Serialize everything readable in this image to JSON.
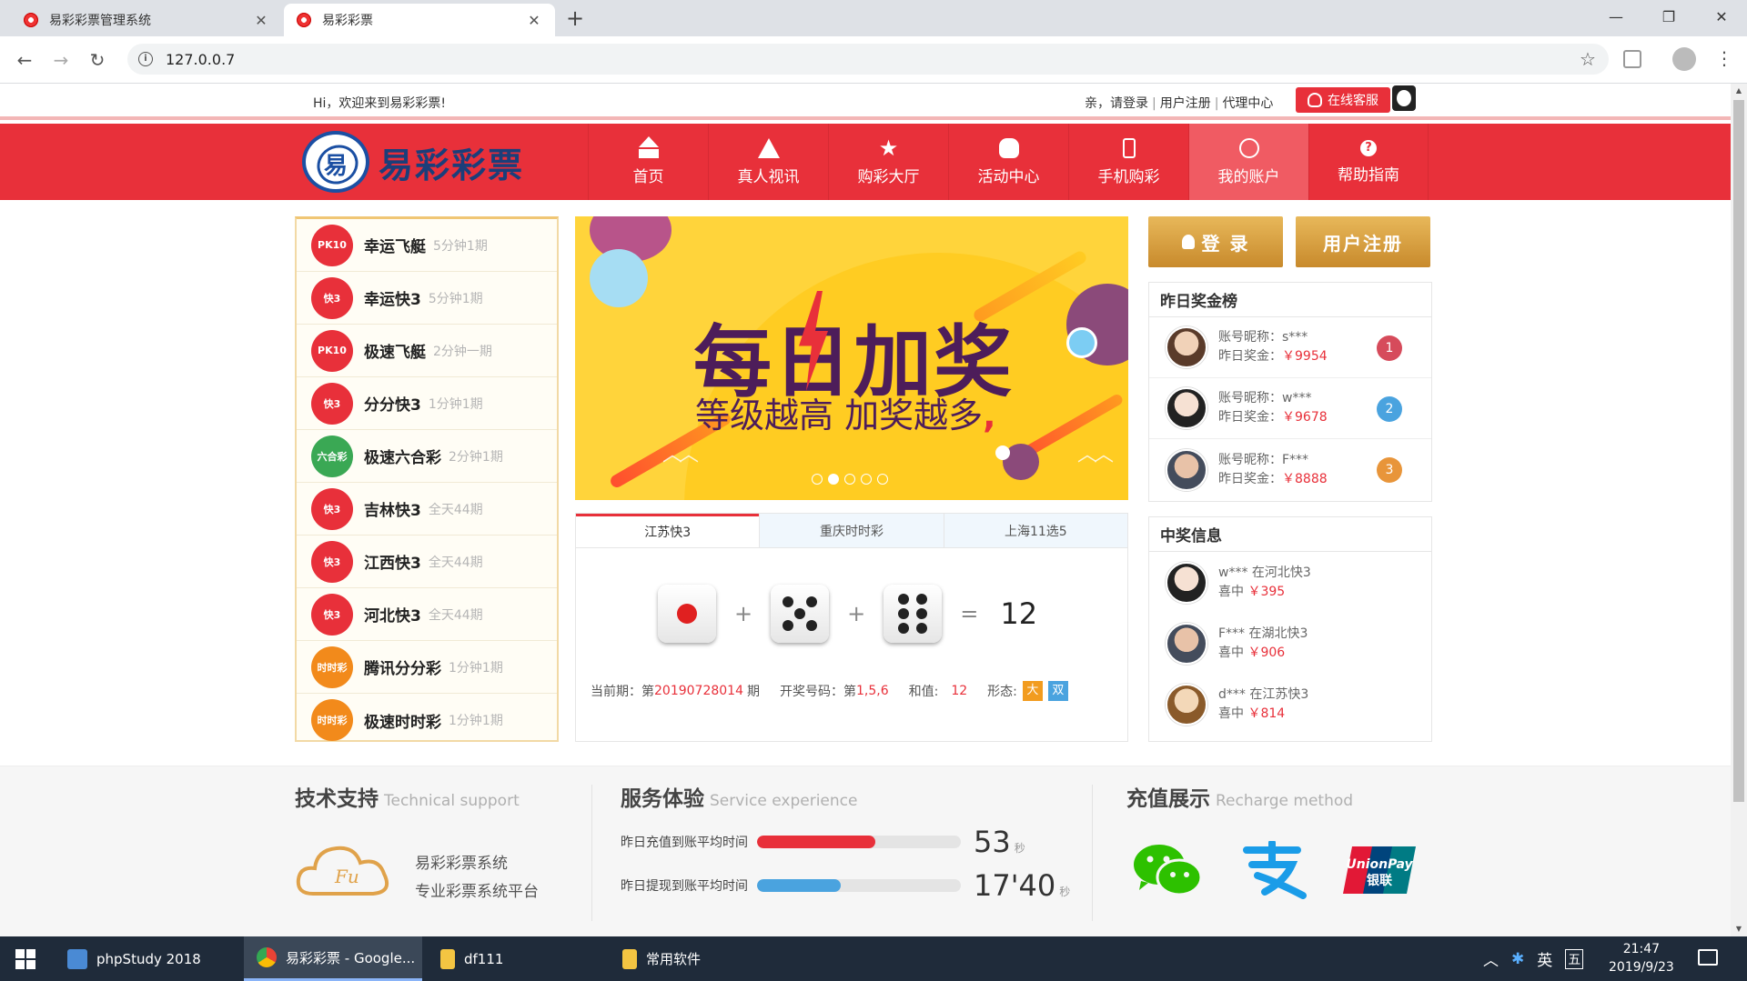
{
  "browser": {
    "tabs": [
      {
        "title": "易彩彩票管理系统",
        "active": false
      },
      {
        "title": "易彩彩票",
        "active": true
      }
    ],
    "url": "127.0.0.7"
  },
  "topbar": {
    "welcome": "Hi，欢迎来到易彩彩票!",
    "login_link": "亲，请登录",
    "register_link": "用户注册",
    "agent_link": "代理中心",
    "service_button": "在线客服"
  },
  "header": {
    "logo_text": "易彩彩票",
    "nav": [
      {
        "label": "首页",
        "icon": "home-icon"
      },
      {
        "label": "真人视讯",
        "icon": "triangle-icon"
      },
      {
        "label": "购彩大厅",
        "icon": "star-icon"
      },
      {
        "label": "活动中心",
        "icon": "money-bag-icon"
      },
      {
        "label": "手机购彩",
        "icon": "phone-icon"
      },
      {
        "label": "我的账户",
        "icon": "user-icon",
        "active": true
      },
      {
        "label": "帮助指南",
        "icon": "help-icon"
      }
    ]
  },
  "lotteries": [
    {
      "name": "幸运飞艇",
      "freq": "5分钟1期",
      "badge": "PK10",
      "color": "#e8303a"
    },
    {
      "name": "幸运快3",
      "freq": "5分钟1期",
      "badge": "快3",
      "color": "#e8303a"
    },
    {
      "name": "极速飞艇",
      "freq": "2分钟一期",
      "badge": "PK10",
      "color": "#e8303a"
    },
    {
      "name": "分分快3",
      "freq": "1分钟1期",
      "badge": "快3",
      "color": "#e8303a"
    },
    {
      "name": "极速六合彩",
      "freq": "2分钟1期",
      "badge": "六合彩",
      "color": "#3aa854"
    },
    {
      "name": "吉林快3",
      "freq": "全天44期",
      "badge": "快3",
      "color": "#e8303a"
    },
    {
      "name": "江西快3",
      "freq": "全天44期",
      "badge": "快3",
      "color": "#e8303a"
    },
    {
      "name": "河北快3",
      "freq": "全天44期",
      "badge": "快3",
      "color": "#e8303a"
    },
    {
      "name": "腾讯分分彩",
      "freq": "1分钟1期",
      "badge": "时时彩",
      "color": "#f28a1b"
    },
    {
      "name": "极速时时彩",
      "freq": "1分钟1期",
      "badge": "时时彩",
      "color": "#f28a1b"
    }
  ],
  "banner": {
    "headline": "每日加奖",
    "subline": "等级越高 加奖越多",
    "comma": ",",
    "slides": 5,
    "current_slide": 2
  },
  "draw": {
    "tabs": [
      "江苏快3",
      "重庆时时彩",
      "上海11选5"
    ],
    "active_tab": 0,
    "dice": [
      1,
      5,
      6
    ],
    "plus": "+",
    "equals": "=",
    "sum": "12",
    "period_label": "当前期：第",
    "period": "20190728014",
    "period_suffix": "期",
    "numbers_label": "开奖号码：第",
    "numbers": "1,5,6",
    "sum_label": "和值:",
    "sum_value": "12",
    "shape_label": "形态:",
    "shape_big": "大",
    "shape_double": "双"
  },
  "account": {
    "login_button": "登 录",
    "register_button": "用户注册"
  },
  "ranking": {
    "title": "昨日奖金榜",
    "name_label": "账号昵称：",
    "prize_label": "昨日奖金：",
    "items": [
      {
        "name": "s***",
        "prize": "￥9954",
        "rank": "1"
      },
      {
        "name": "w***",
        "prize": "￥9678",
        "rank": "2"
      },
      {
        "name": "F***",
        "prize": "￥8888",
        "rank": "3"
      }
    ]
  },
  "winners": {
    "title": "中奖信息",
    "hit_label": "喜中",
    "items": [
      {
        "who": "w*** 在河北快3",
        "amount": "￥395"
      },
      {
        "who": "F*** 在湖北快3",
        "amount": "￥906"
      },
      {
        "who": "d*** 在江苏快3",
        "amount": "￥814"
      }
    ]
  },
  "footer": {
    "support": {
      "title": "技术支持",
      "title_en": "Technical support",
      "line1": "易彩彩票系统",
      "line2": "专业彩票系统平台",
      "logo_text": "Fu"
    },
    "service": {
      "title": "服务体验",
      "title_en": "Service experience",
      "rows": [
        {
          "label": "昨日充值到账平均时间",
          "value": "53",
          "unit": "秒",
          "fill": 0.58,
          "color": "#e8303a"
        },
        {
          "label": "昨日提现到账平均时间",
          "value": "17'40",
          "unit": "秒",
          "fill": 0.41,
          "color": "#4aa3df"
        }
      ]
    },
    "recharge": {
      "title": "充值展示",
      "title_en": "Recharge method",
      "unionpay_text": "UnionPay",
      "unionpay_cn": "银联"
    }
  },
  "taskbar": {
    "items": [
      {
        "label": "phpStudy 2018",
        "active": false
      },
      {
        "label": "易彩彩票 - Google...",
        "active": true
      },
      {
        "label": "df111",
        "active": false
      },
      {
        "label": "常用软件",
        "active": false
      }
    ],
    "ime": "英",
    "ime2": "五",
    "time": "21:47",
    "date": "2019/9/23"
  }
}
